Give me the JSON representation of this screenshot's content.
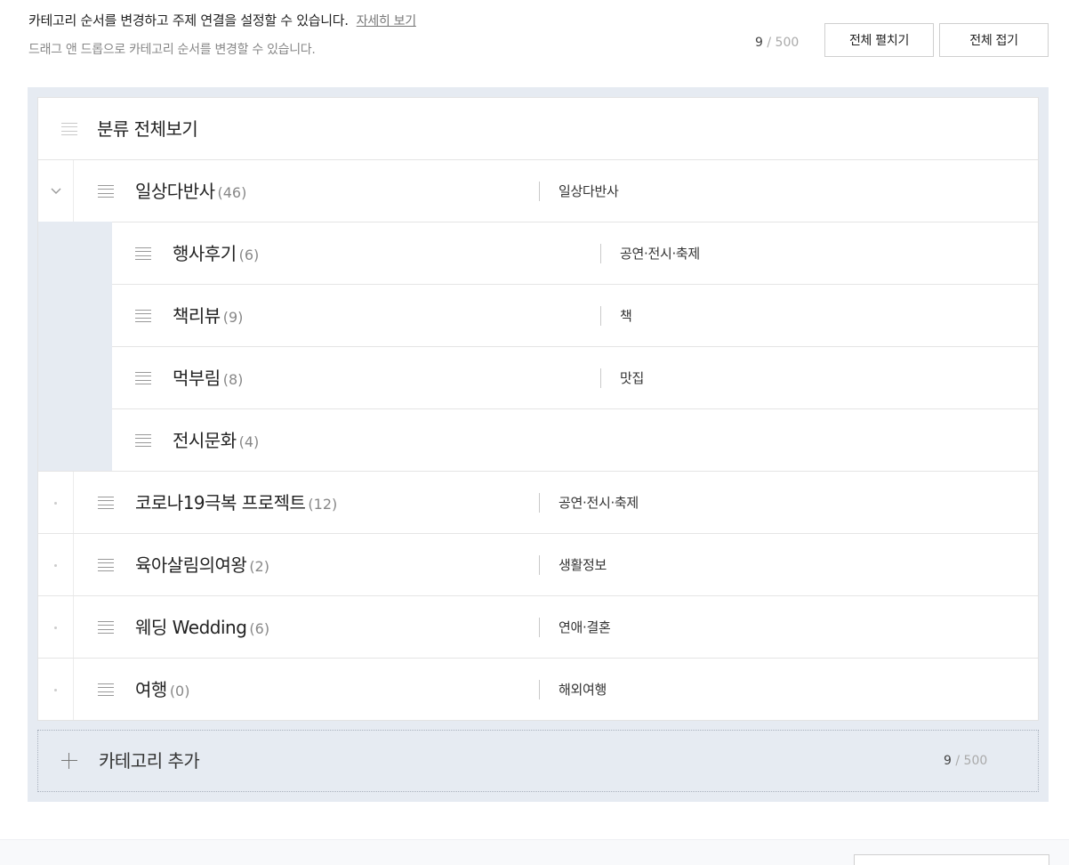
{
  "header": {
    "description": "카테고리 순서를 변경하고 주제 연결을 설정할 수 있습니다.",
    "more_link": "자세히 보기",
    "hint": "드래그 앤 드롭으로 카테고리 순서를 변경할 수 있습니다.",
    "count": "9",
    "separator": "/",
    "max": "500",
    "expand_all": "전체 펼치기",
    "collapse_all": "전체 접기"
  },
  "root": {
    "label": "분류 전체보기"
  },
  "categories": [
    {
      "name": "일상다반사",
      "count": "(46)",
      "topic": "일상다반사",
      "expanded": true,
      "children": [
        {
          "name": "행사후기",
          "count": "(6)",
          "topic": "공연·전시·축제"
        },
        {
          "name": "책리뷰",
          "count": "(9)",
          "topic": "책"
        },
        {
          "name": "먹부림",
          "count": "(8)",
          "topic": "맛집"
        },
        {
          "name": "전시문화",
          "count": "(4)",
          "topic": ""
        }
      ]
    },
    {
      "name": "코로나19극복 프로젝트",
      "count": "(12)",
      "topic": "공연·전시·축제"
    },
    {
      "name": "육아살림의여왕",
      "count": "(2)",
      "topic": "생활정보"
    },
    {
      "name": "웨딩 Wedding",
      "count": "(6)",
      "topic": "연애·결혼"
    },
    {
      "name": "여행",
      "count": "(0)",
      "topic": "해외여행"
    }
  ],
  "add_category": {
    "label": "카테고리 추가",
    "count": "9",
    "separator": "/",
    "max": "500"
  },
  "colors": {
    "panel_bg": "#e6ebf2",
    "text": "#222222",
    "muted": "#888888"
  },
  "icons": {
    "drag": "drag-handle-icon",
    "expand": "chevron-down-icon",
    "add": "plus-icon"
  }
}
